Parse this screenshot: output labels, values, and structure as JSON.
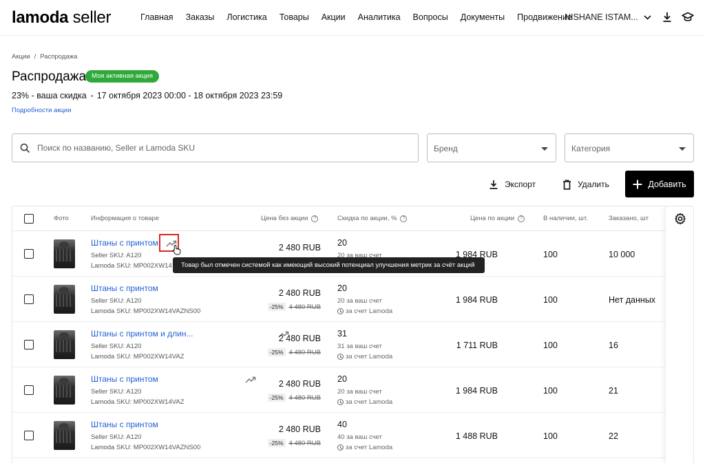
{
  "header": {
    "logo_main": "lamoda",
    "logo_sub": "seller",
    "nav": [
      "Главная",
      "Заказы",
      "Логистика",
      "Товары",
      "Акции",
      "Аналитика",
      "Вопросы",
      "Документы",
      "Продвижение"
    ],
    "account_name": "NISHANE ISTAM..."
  },
  "breadcrumb": [
    "Акции",
    "Распродажа"
  ],
  "breadcrumb_sep": "/",
  "page": {
    "title": "Распродажа",
    "badge": "Моя активная акция",
    "discount_text": "23% - ваша скидка",
    "period": "17 октября 2023 00:00 - 18 октября 2023 23:59",
    "details_link": "Подробности акции"
  },
  "filters": {
    "search_placeholder": "Поиск по названию, Seller и Lamoda SKU",
    "brand_placeholder": "Бренд",
    "category_placeholder": "Категория"
  },
  "actions": {
    "export": "Экспорт",
    "delete": "Удалить",
    "add": "Добавить"
  },
  "table": {
    "columns": {
      "photo": "Фото",
      "info": "Информация о товаре",
      "price_no_promo": "Цена без акции",
      "discount": "Скидка по акции, %",
      "promo_price": "Цена по акции",
      "in_stock": "В наличии, шт.",
      "ordered": "Заказано, шт"
    },
    "rows": [
      {
        "name": "Штаны с принтом",
        "trend": true,
        "seller_sku": "Seller SKU: A120",
        "lamoda_sku": "Lamoda SKU: MP002XW14",
        "price": "2 480 RUB",
        "pct": "",
        "old_price": "",
        "discount": "20",
        "seller_part": "20 за ваш счет",
        "lamoda_part": "",
        "promo_price": "1 984 RUB",
        "stock": "100",
        "ordered": "10 000"
      },
      {
        "name": "Штаны с принтом",
        "trend": false,
        "seller_sku": "Seller SKU: A120",
        "lamoda_sku": "Lamoda SKU: MP002XW14VAZNS00",
        "price": "2 480 RUB",
        "pct": "-25%",
        "old_price": "4 480 RUB",
        "discount": "20",
        "seller_part": "20 за ваш счет",
        "lamoda_part": "за счет Lamoda",
        "promo_price": "1 984 RUB",
        "stock": "100",
        "ordered": "Нет данных"
      },
      {
        "name": "Штаны с принтом и длин...",
        "trend": true,
        "seller_sku": "Seller SKU: A120",
        "lamoda_sku": "Lamoda SKU: MP002XW14VAZ",
        "price": "2 480 RUB",
        "pct": "-25%",
        "old_price": "4 480 RUB",
        "discount": "31",
        "seller_part": "31 за ваш счет",
        "lamoda_part": "за счет Lamoda",
        "promo_price": "1 711 RUB",
        "stock": "100",
        "ordered": "16"
      },
      {
        "name": "Штаны с принтом",
        "trend": true,
        "seller_sku": "Seller SKU: A120",
        "lamoda_sku": "Lamoda SKU: MP002XW14VAZ",
        "price": "2 480 RUB",
        "pct": "-25%",
        "old_price": "4 480 RUB",
        "discount": "20",
        "seller_part": "20 за ваш счет",
        "lamoda_part": "за счет Lamoda",
        "promo_price": "1 984 RUB",
        "stock": "100",
        "ordered": "21"
      },
      {
        "name": "Штаны с принтом",
        "trend": false,
        "seller_sku": "Seller SKU: A120",
        "lamoda_sku": "Lamoda SKU: MP002XW14VAZNS00",
        "price": "2 480 RUB",
        "pct": "-25%",
        "old_price": "4 480 RUB",
        "discount": "40",
        "seller_part": "40 за ваш счет",
        "lamoda_part": "за счет Lamoda",
        "promo_price": "1 488 RUB",
        "stock": "100",
        "ordered": "22"
      }
    ]
  },
  "tooltip": "Товар был отмечен системой как имеющий высокий потенциал улучшения метрик за счёт акций",
  "colors": {
    "accent_link": "#2461d4",
    "badge_green": "#2eaa3a",
    "highlight_red": "#d8261f"
  }
}
